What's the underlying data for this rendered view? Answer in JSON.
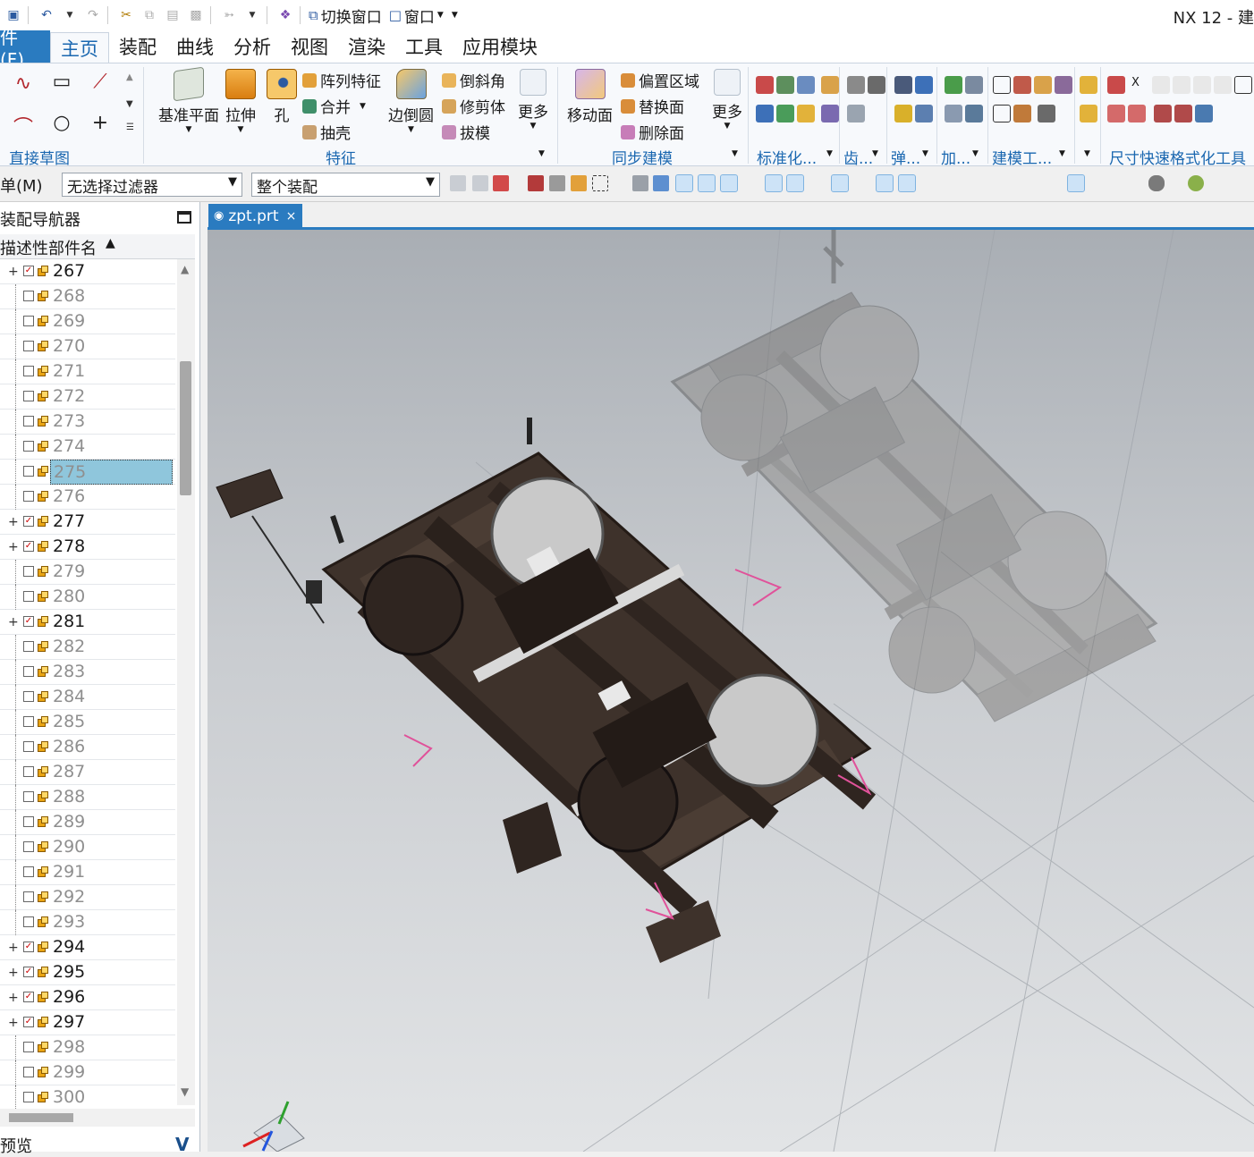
{
  "quick_access": {
    "switch_window": "切换窗口",
    "window": "窗口",
    "app_title": "NX 12 - 建"
  },
  "menu_tabs": {
    "file": "件(F)",
    "items": [
      "主页",
      "装配",
      "曲线",
      "分析",
      "视图",
      "渲染",
      "工具",
      "应用模块"
    ]
  },
  "ribbon": {
    "groups": [
      "直接草图",
      "特征",
      "同步建模",
      "标准化...",
      "齿...",
      "弹...",
      "加...",
      "建模工...",
      "尺寸快速格式化工具"
    ],
    "feature": {
      "datum_plane": "基准平面",
      "extrude": "拉伸",
      "hole": "孔",
      "pattern_feature": "阵列特征",
      "unite": "合并",
      "shell": "抽壳",
      "edge_blend": "边倒圆",
      "chamfer": "倒斜角",
      "trim_body": "修剪体",
      "draft": "拔模",
      "more": "更多"
    },
    "sync": {
      "move_face": "移动面",
      "offset_region": "偏置区域",
      "replace_face": "替换面",
      "delete_face": "删除面",
      "more": "更多"
    }
  },
  "filterbar": {
    "menu": "单(M)",
    "selection_filter": "无选择过滤器",
    "scope": "整个装配"
  },
  "navigator": {
    "title": "装配导航器",
    "column": "描述性部件名",
    "rows": [
      {
        "name": "267",
        "checked": true,
        "expandable": true
      },
      {
        "name": "268",
        "checked": false,
        "expandable": false
      },
      {
        "name": "269",
        "checked": false,
        "expandable": false
      },
      {
        "name": "270",
        "checked": false,
        "expandable": false
      },
      {
        "name": "271",
        "checked": false,
        "expandable": false
      },
      {
        "name": "272",
        "checked": false,
        "expandable": false
      },
      {
        "name": "273",
        "checked": false,
        "expandable": false
      },
      {
        "name": "274",
        "checked": false,
        "expandable": false
      },
      {
        "name": "275",
        "checked": false,
        "expandable": false,
        "selected": true
      },
      {
        "name": "276",
        "checked": false,
        "expandable": false
      },
      {
        "name": "277",
        "checked": true,
        "expandable": true
      },
      {
        "name": "278",
        "checked": true,
        "expandable": true
      },
      {
        "name": "279",
        "checked": false,
        "expandable": false
      },
      {
        "name": "280",
        "checked": false,
        "expandable": false
      },
      {
        "name": "281",
        "checked": true,
        "expandable": true
      },
      {
        "name": "282",
        "checked": false,
        "expandable": false
      },
      {
        "name": "283",
        "checked": false,
        "expandable": false
      },
      {
        "name": "284",
        "checked": false,
        "expandable": false
      },
      {
        "name": "285",
        "checked": false,
        "expandable": false
      },
      {
        "name": "286",
        "checked": false,
        "expandable": false
      },
      {
        "name": "287",
        "checked": false,
        "expandable": false
      },
      {
        "name": "288",
        "checked": false,
        "expandable": false
      },
      {
        "name": "289",
        "checked": false,
        "expandable": false
      },
      {
        "name": "290",
        "checked": false,
        "expandable": false
      },
      {
        "name": "291",
        "checked": false,
        "expandable": false
      },
      {
        "name": "292",
        "checked": false,
        "expandable": false
      },
      {
        "name": "293",
        "checked": false,
        "expandable": false
      },
      {
        "name": "294",
        "checked": true,
        "expandable": true
      },
      {
        "name": "295",
        "checked": true,
        "expandable": true
      },
      {
        "name": "296",
        "checked": true,
        "expandable": true
      },
      {
        "name": "297",
        "checked": true,
        "expandable": true
      },
      {
        "name": "298",
        "checked": false,
        "expandable": false
      },
      {
        "name": "299",
        "checked": false,
        "expandable": false
      },
      {
        "name": "300",
        "checked": false,
        "expandable": false
      }
    ],
    "preview": "预览"
  },
  "document_tab": {
    "name": "zpt.prt",
    "close": "×"
  },
  "colors": {
    "accent": "#2a7bc0",
    "ribbon_label": "#1a67b0",
    "selection": "#8fc6dc",
    "frame": "#3c2f28"
  }
}
